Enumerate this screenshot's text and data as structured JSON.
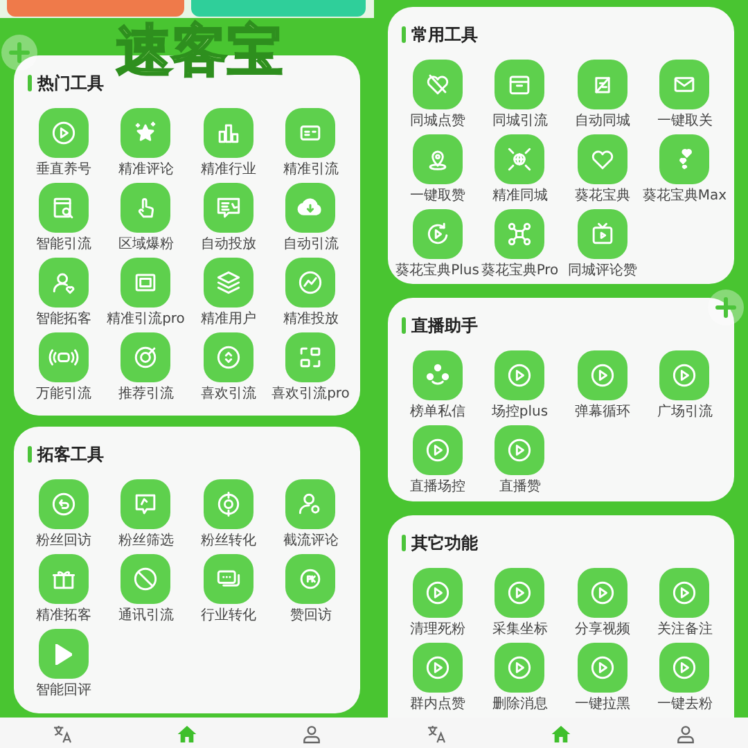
{
  "overlay_title": "速客宝",
  "left_screen": {
    "sections": [
      {
        "title": "热门工具",
        "tools": [
          {
            "label": "垂直养号"
          },
          {
            "label": "精准评论"
          },
          {
            "label": "精准行业"
          },
          {
            "label": "精准引流"
          },
          {
            "label": "智能引流"
          },
          {
            "label": "区域爆粉"
          },
          {
            "label": "自动投放"
          },
          {
            "label": "自动引流"
          },
          {
            "label": "智能拓客"
          },
          {
            "label": "精准引流pro"
          },
          {
            "label": "精准用户"
          },
          {
            "label": "精准投放"
          },
          {
            "label": "万能引流"
          },
          {
            "label": "推荐引流"
          },
          {
            "label": "喜欢引流"
          },
          {
            "label": "喜欢引流pro"
          }
        ]
      },
      {
        "title": "拓客工具",
        "tools": [
          {
            "label": "粉丝回访"
          },
          {
            "label": "粉丝筛选"
          },
          {
            "label": "粉丝转化"
          },
          {
            "label": "截流评论"
          },
          {
            "label": "精准拓客"
          },
          {
            "label": "通讯引流"
          },
          {
            "label": "行业转化"
          },
          {
            "label": "赞回访"
          },
          {
            "label": "智能回评"
          }
        ]
      }
    ],
    "nav": [
      {
        "selected": false
      },
      {
        "selected": true
      },
      {
        "selected": false
      }
    ]
  },
  "right_screen": {
    "sections": [
      {
        "title": "常用工具",
        "tools": [
          {
            "label": "同城点赞"
          },
          {
            "label": "同城引流"
          },
          {
            "label": "自动同城"
          },
          {
            "label": "一键取关"
          },
          {
            "label": "一键取赞"
          },
          {
            "label": "精准同城"
          },
          {
            "label": "葵花宝典"
          },
          {
            "label": "葵花宝典Max"
          },
          {
            "label": "葵花宝典Plus"
          },
          {
            "label": "葵花宝典Pro"
          },
          {
            "label": "同城评论赞"
          }
        ]
      },
      {
        "title": "直播助手",
        "tools": [
          {
            "label": "榜单私信"
          },
          {
            "label": "场控plus"
          },
          {
            "label": "弹幕循环"
          },
          {
            "label": "广场引流"
          },
          {
            "label": "直播场控"
          },
          {
            "label": "直播赞"
          }
        ]
      },
      {
        "title": "其它功能",
        "tools": [
          {
            "label": "清理死粉"
          },
          {
            "label": "采集坐标"
          },
          {
            "label": "分享视频"
          },
          {
            "label": "关注备注"
          },
          {
            "label": "群内点赞"
          },
          {
            "label": "删除消息"
          },
          {
            "label": "一键拉黑"
          },
          {
            "label": "一键去粉"
          }
        ]
      }
    ],
    "nav": [
      {
        "selected": false
      },
      {
        "selected": true
      },
      {
        "selected": false
      }
    ]
  }
}
